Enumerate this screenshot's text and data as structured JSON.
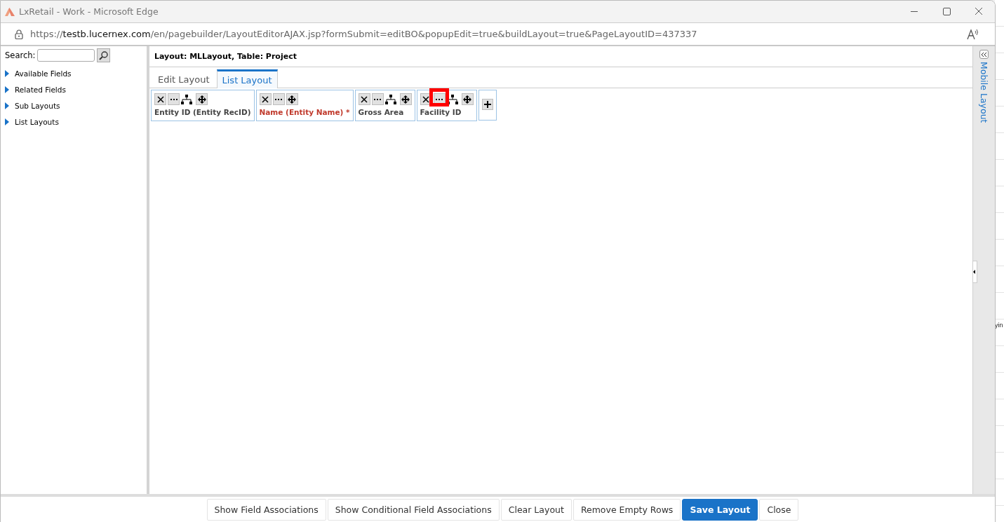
{
  "window": {
    "title": "LxRetail - Work - Microsoft Edge"
  },
  "address": {
    "scheme": "https://",
    "host": "testb.lucernex.com",
    "path": "/en/pagebuilder/LayoutEditorAJAX.jsp?formSubmit=editBO&popupEdit=true&buildLayout=true&PageLayoutID=437337"
  },
  "sidebar": {
    "search_label": "Search:",
    "items": [
      {
        "label": "Available Fields",
        "expanded": false
      },
      {
        "label": "Related Fields",
        "expanded": false
      },
      {
        "label": "Sub Layouts",
        "expanded": false
      },
      {
        "label": "List Layouts",
        "expanded": false
      }
    ]
  },
  "layout_header": "Layout: MLLayout, Table: Project",
  "tabs": [
    {
      "label": "Edit Layout",
      "selected": false
    },
    {
      "label": "List Layout",
      "selected": true
    }
  ],
  "fields": [
    {
      "label": "Entity ID (Entity RecID)",
      "required": false,
      "tools": [
        {
          "kind": "remove",
          "highlighted": false
        },
        {
          "kind": "more",
          "highlighted": false
        },
        {
          "kind": "hierarchy",
          "highlighted": false
        },
        {
          "kind": "move",
          "highlighted": false
        }
      ]
    },
    {
      "label": "Name (Entity Name) *",
      "required": true,
      "tools": [
        {
          "kind": "remove",
          "highlighted": false
        },
        {
          "kind": "more",
          "highlighted": false
        },
        {
          "kind": "move",
          "highlighted": false
        }
      ]
    },
    {
      "label": "Gross Area",
      "required": false,
      "tools": [
        {
          "kind": "remove",
          "highlighted": false
        },
        {
          "kind": "more",
          "highlighted": false
        },
        {
          "kind": "hierarchy",
          "highlighted": false
        },
        {
          "kind": "move",
          "highlighted": false
        }
      ]
    },
    {
      "label": "Facility ID",
      "required": false,
      "tools": [
        {
          "kind": "remove",
          "highlighted": false
        },
        {
          "kind": "more",
          "highlighted": true
        },
        {
          "kind": "hierarchy",
          "highlighted": false
        },
        {
          "kind": "move",
          "highlighted": false
        }
      ]
    }
  ],
  "side_panel": {
    "label": "Mobile Layout",
    "collapsed": true
  },
  "buttons": [
    {
      "label": "Show Field Associations",
      "primary": false
    },
    {
      "label": "Show Conditional Field Associations",
      "primary": false
    },
    {
      "label": "Clear Layout",
      "primary": false
    },
    {
      "label": "Remove Empty Rows",
      "primary": false
    },
    {
      "label": "Save Layout",
      "primary": true
    },
    {
      "label": "Close",
      "primary": false
    }
  ],
  "background_text": "yin"
}
